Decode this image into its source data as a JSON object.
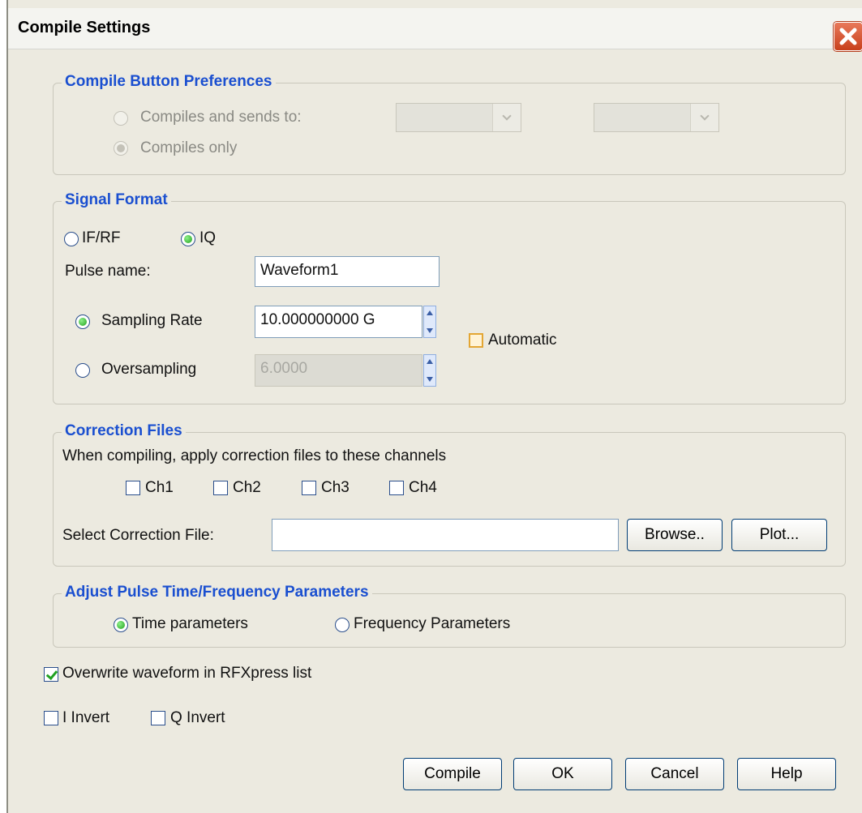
{
  "window": {
    "title": "Compile Settings"
  },
  "compile_prefs": {
    "legend": "Compile Button Preferences",
    "sends_label": "Compiles and sends to:",
    "only_label": "Compiles only",
    "combo1_value": "",
    "combo2_value": ""
  },
  "signal_format": {
    "legend": "Signal Format",
    "ifrf_label": "IF/RF",
    "iq_label": "IQ",
    "pulse_name_label": "Pulse name:",
    "pulse_name_value": "Waveform1",
    "sampling_rate_label": "Sampling Rate",
    "sampling_rate_value": "10.000000000 G",
    "oversampling_label": "Oversampling",
    "oversampling_value": "6.0000",
    "automatic_label": "Automatic"
  },
  "correction": {
    "legend": "Correction Files",
    "description": "When compiling, apply correction files to these channels",
    "channels": [
      "Ch1",
      "Ch2",
      "Ch3",
      "Ch4"
    ],
    "select_label": "Select Correction File:",
    "file_value": "",
    "browse_label": "Browse..",
    "plot_label": "Plot..."
  },
  "adjust": {
    "legend": "Adjust Pulse Time/Frequency Parameters",
    "time_label": "Time parameters",
    "freq_label": "Frequency Parameters"
  },
  "options": {
    "overwrite_label": "Overwrite waveform in RFXpress list",
    "i_invert_label": "I Invert",
    "q_invert_label": "Q Invert"
  },
  "buttons": {
    "compile": "Compile",
    "ok": "OK",
    "cancel": "Cancel",
    "help": "Help"
  },
  "colors": {
    "legend": "#1a4fd0",
    "radio_on": "#22a21e",
    "check_on": "#21a121"
  }
}
